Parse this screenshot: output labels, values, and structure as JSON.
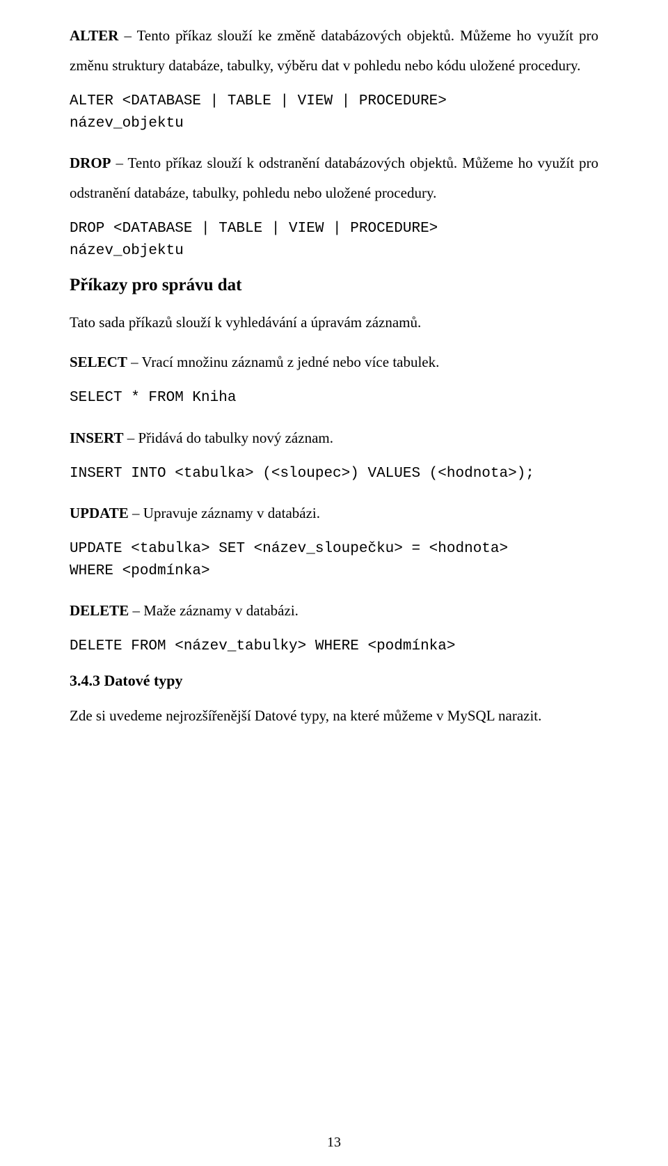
{
  "p1": {
    "term": "ALTER",
    "rest": " – Tento příkaz slouží ke změně databázových objektů. Můžeme ho využít pro změnu struktury databáze, tabulky, výběru dat v pohledu nebo kódu uložené procedury."
  },
  "code1": "ALTER <DATABASE | TABLE | VIEW | PROCEDURE>\nnázev_objektu",
  "p2": {
    "term": "DROP",
    "rest": " – Tento příkaz slouží k odstranění databázových objektů. Můžeme ho využít pro odstranění databáze, tabulky, pohledu nebo uložené procedury."
  },
  "code2": "DROP <DATABASE | TABLE | VIEW | PROCEDURE>\nnázev_objektu",
  "h2_1": "Příkazy pro správu dat",
  "p3": "Tato sada příkazů slouží k vyhledávání a úpravám záznamů.",
  "p4": {
    "term": "SELECT",
    "rest": " – Vrací množinu záznamů z jedné nebo více tabulek."
  },
  "code3": "SELECT * FROM Kniha",
  "p5": {
    "term": "INSERT",
    "rest": " – Přidává do tabulky nový záznam."
  },
  "code4": "INSERT INTO <tabulka> (<sloupec>) VALUES (<hodnota>);",
  "p6": {
    "term": "UPDATE",
    "rest": " – Upravuje záznamy v databázi."
  },
  "code5": "UPDATE <tabulka> SET <název_sloupečku> = <hodnota>\nWHERE <podmínka>",
  "p7": {
    "term": "DELETE",
    "rest": " – Maže záznamy v databázi."
  },
  "code6": "DELETE FROM <název_tabulky> WHERE <podmínka>",
  "h3_1": "3.4.3 Datové typy",
  "p8": "Zde si uvedeme nejrozšířenější Datové typy, na které můžeme v MySQL narazit.",
  "page_number": "13"
}
